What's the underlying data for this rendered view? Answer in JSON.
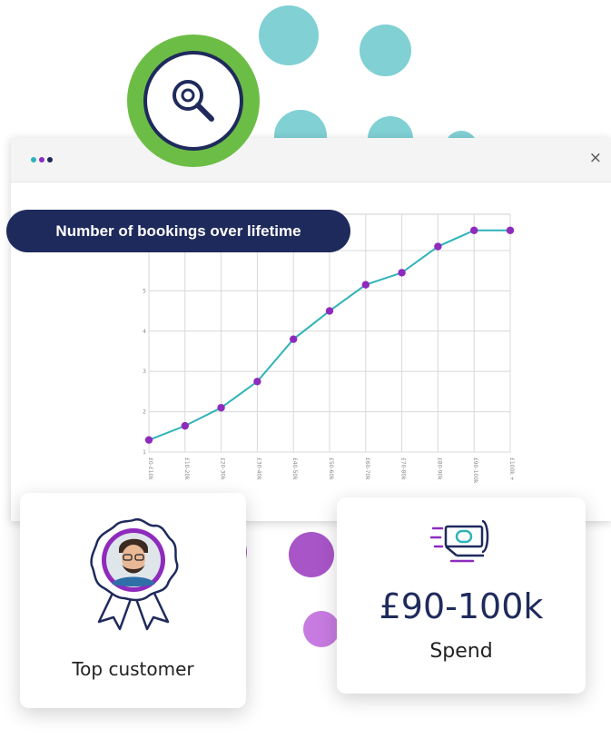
{
  "window": {
    "close_label": "×",
    "dot_colors": [
      "#2fb3b8",
      "#8e2bbd",
      "#1f2a5c"
    ]
  },
  "badge": {
    "label": "Number of bookings over lifetime"
  },
  "icons": {
    "search": "search-icon",
    "rosette": "rosette-icon",
    "money": "money-icon"
  },
  "colors": {
    "navy": "#1f2a5c",
    "green": "#6cbd45",
    "teal": "#80d0d4",
    "purple": "#8e2bbd",
    "line": "#2fb3b8"
  },
  "chart_data": {
    "type": "line",
    "x": [
      "£0-£10k",
      "£10-20k",
      "£20-30k",
      "£30-40k",
      "£40-50k",
      "£50-60k",
      "£60-70k",
      "£70-80k",
      "£80-90k",
      "£90-100k",
      "£100k +"
    ],
    "series": [
      {
        "values": [
          1.3,
          1.65,
          2.1,
          2.75,
          3.8,
          4.5,
          5.15,
          5.45,
          6.1,
          6.5,
          6.5
        ]
      }
    ],
    "yticks": [
      1,
      2,
      3,
      4,
      5,
      6
    ],
    "ylim": [
      1,
      6.9
    ],
    "grid": true
  },
  "cards": {
    "customer": {
      "label": "Top customer"
    },
    "spend": {
      "amount": "£90-100k",
      "label": "Spend"
    }
  }
}
